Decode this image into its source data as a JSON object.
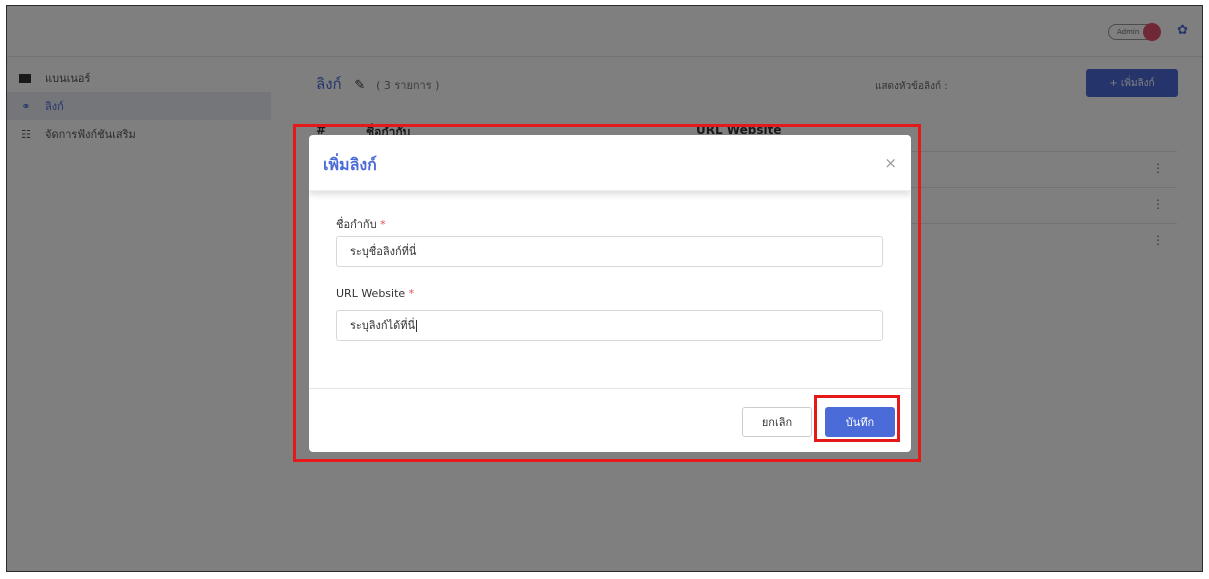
{
  "topbar": {
    "admin_label": "Admin"
  },
  "sidebar": {
    "items": [
      {
        "label": "แบนเนอร์",
        "icon": "image-icon",
        "active": false
      },
      {
        "label": "ลิงก์",
        "icon": "link-icon",
        "active": true
      },
      {
        "label": "จัดการฟังก์ชันเสริม",
        "icon": "sliders-icon",
        "active": false
      }
    ]
  },
  "main": {
    "title": "ลิงก์",
    "count": "( 3 รายการ )",
    "show_label": "แสดงหัวข้อลิงก์ :",
    "add_button": "+ เพิ่มลิงก์",
    "table": {
      "headers": [
        "#",
        "ชื่อกำกับ",
        "URL Website"
      ]
    }
  },
  "modal": {
    "title": "เพิ่มลิงก์",
    "close": "×",
    "fields": [
      {
        "label": "ชื่อกำกับ",
        "required": "*",
        "value": "ระบุชื่อลิงก์ที่นี่"
      },
      {
        "label": "URL Website",
        "required": "*",
        "value": "ระบุลิงก์ได้ที่นี่"
      }
    ],
    "cancel_label": "ยกเลิก",
    "save_label": "บันทึก"
  },
  "colors": {
    "accent": "#4b6bd8",
    "highlight": "#e41919",
    "toggle": "#e0516f"
  }
}
